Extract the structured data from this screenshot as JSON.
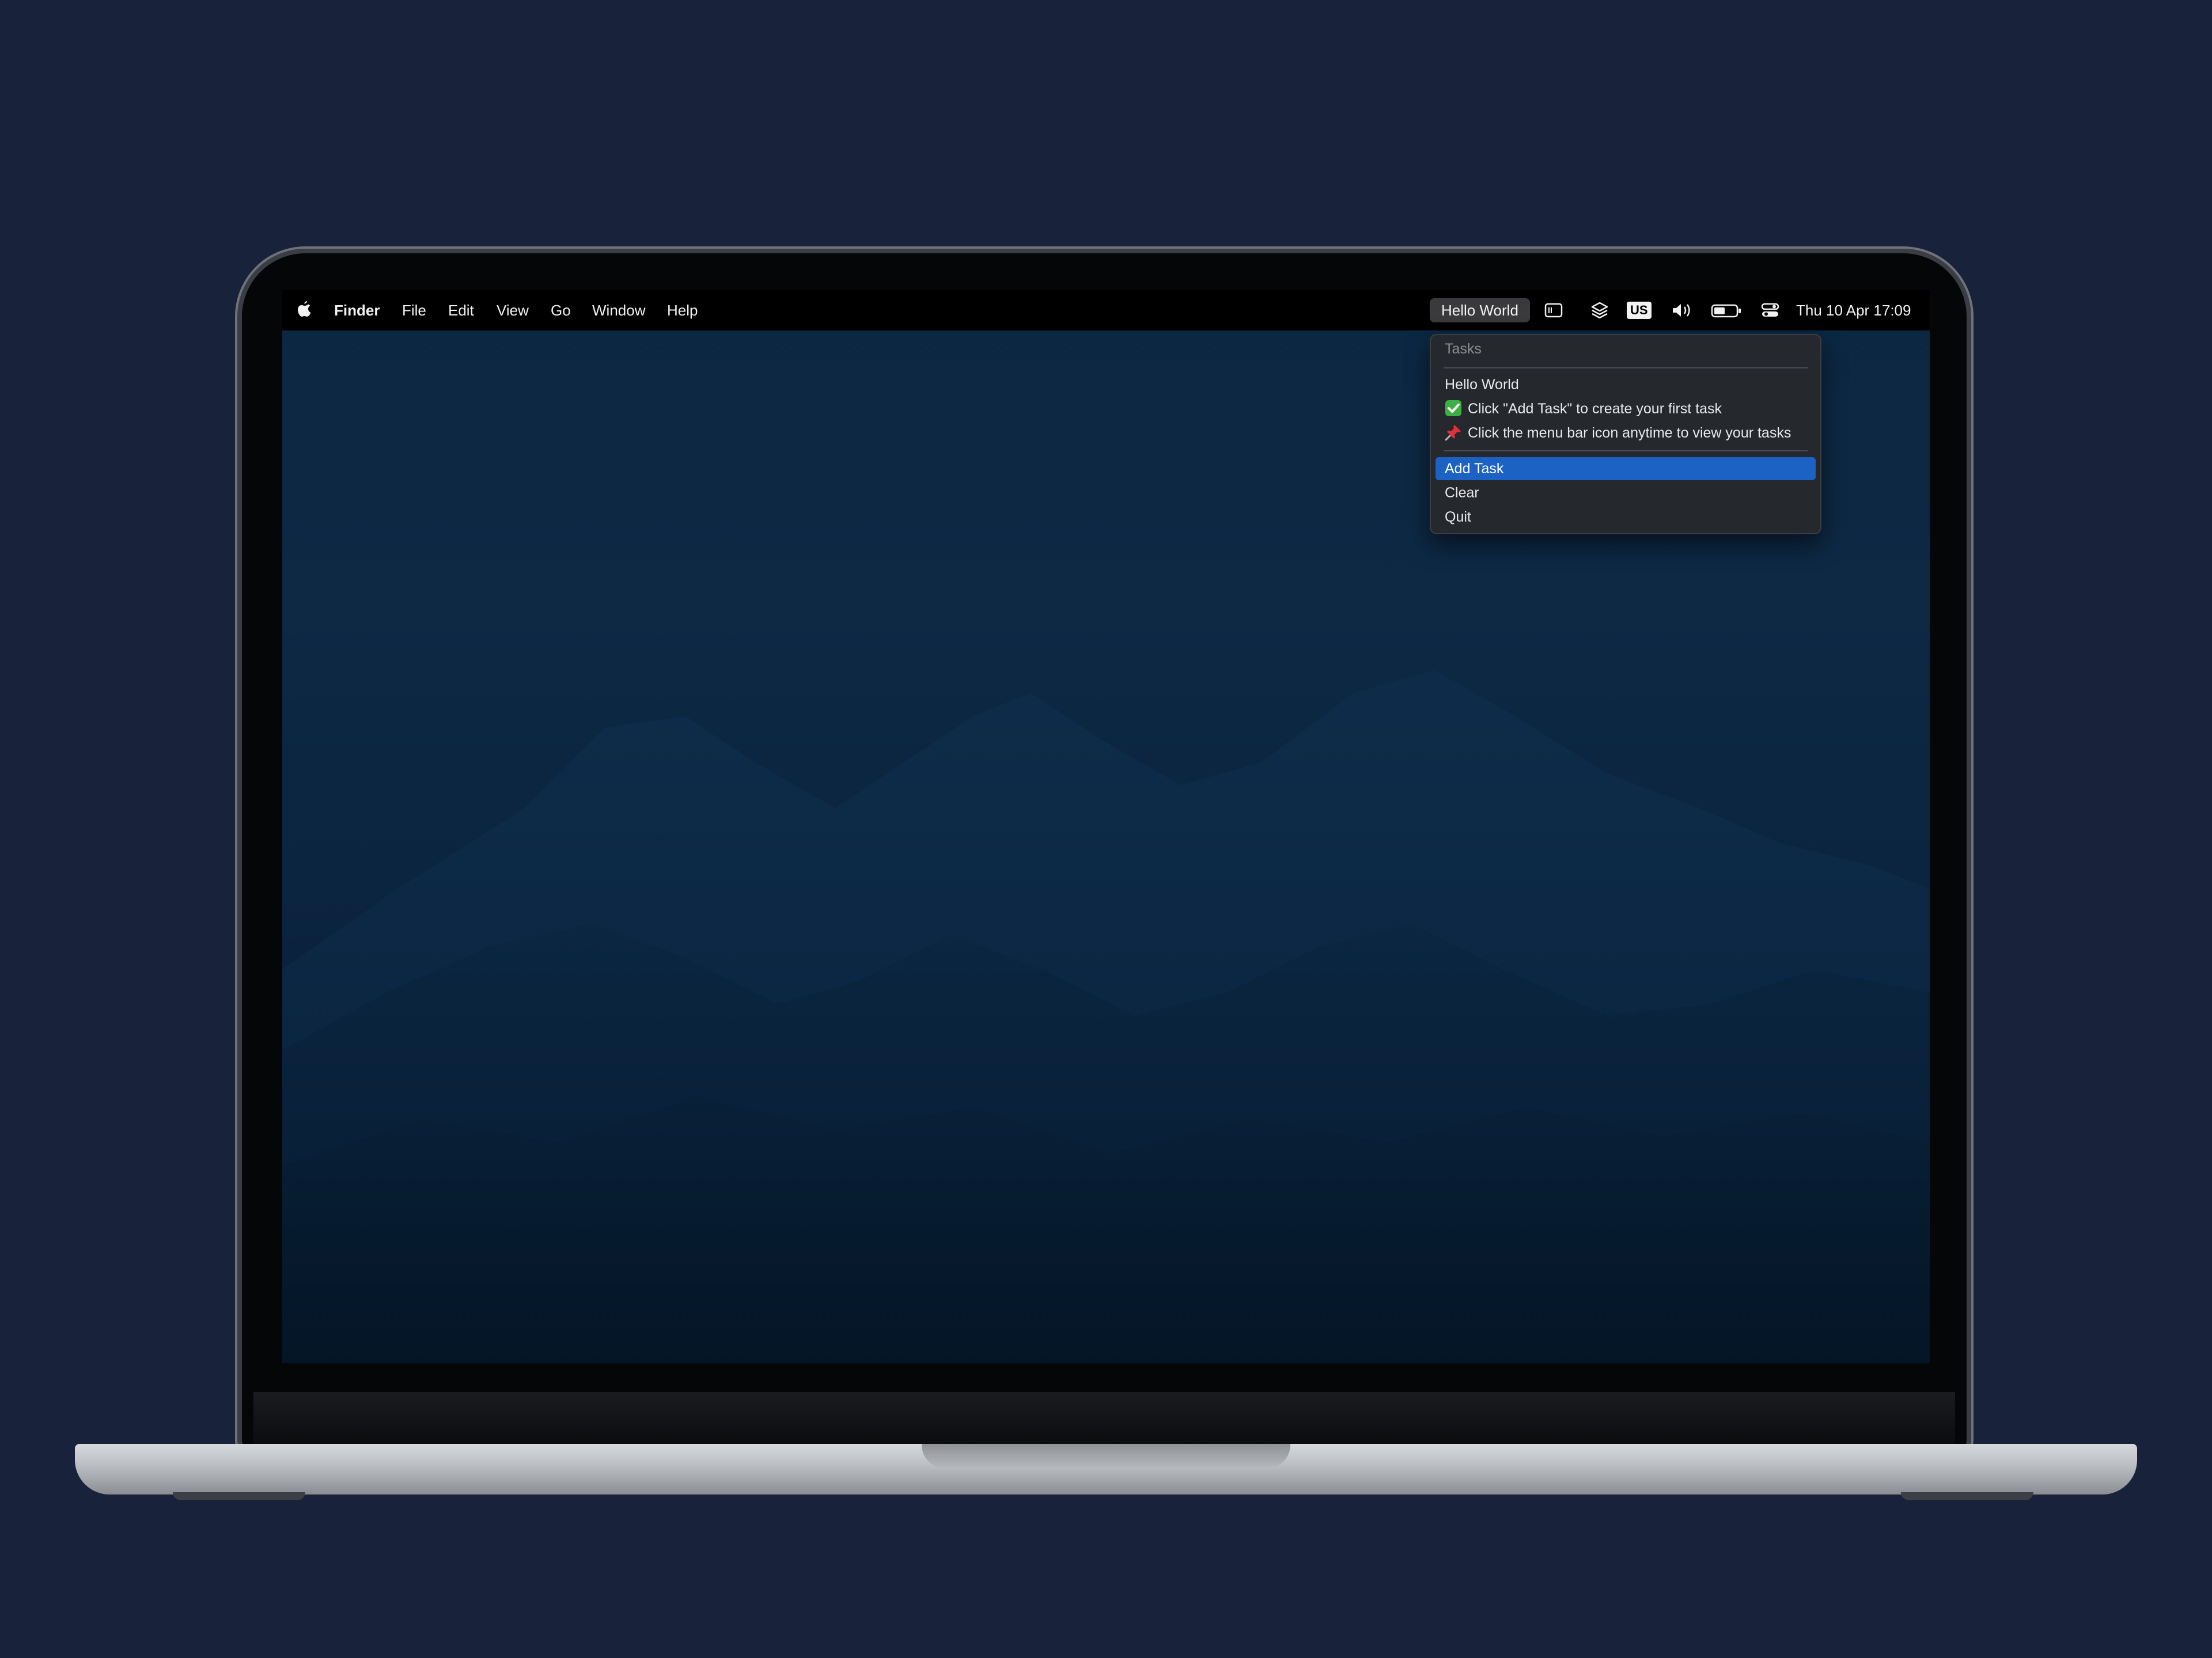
{
  "menubar": {
    "apple_icon": "apple-logo-icon",
    "app_name": "Finder",
    "menus": [
      "File",
      "Edit",
      "View",
      "Go",
      "Window",
      "Help"
    ],
    "status_item_label": "Hello World",
    "status_icons": [
      "screen-mirroring-icon",
      "layers-icon",
      "keyboard-input-icon",
      "volume-icon",
      "battery-icon",
      "control-center-icon"
    ],
    "input_source": "US",
    "datetime": "Thu 10 Apr  17:09"
  },
  "dropdown": {
    "header": "Tasks",
    "tasks": [
      {
        "icon": "",
        "text": "Hello World"
      },
      {
        "icon": "check-box-emoji-icon",
        "text": "Click \"Add Task\" to create your first task"
      },
      {
        "icon": "pushpin-emoji-icon",
        "text": "Click the menu bar icon anytime to view your tasks"
      }
    ],
    "actions": [
      "Add Task",
      "Clear",
      "Quit"
    ],
    "highlighted_action": "Add Task"
  },
  "colors": {
    "background": "#18223a",
    "menu_highlight": "#1c62c4",
    "menu_background": "#25282c",
    "check_green": "#3cb043",
    "pin_red": "#e0303a"
  }
}
